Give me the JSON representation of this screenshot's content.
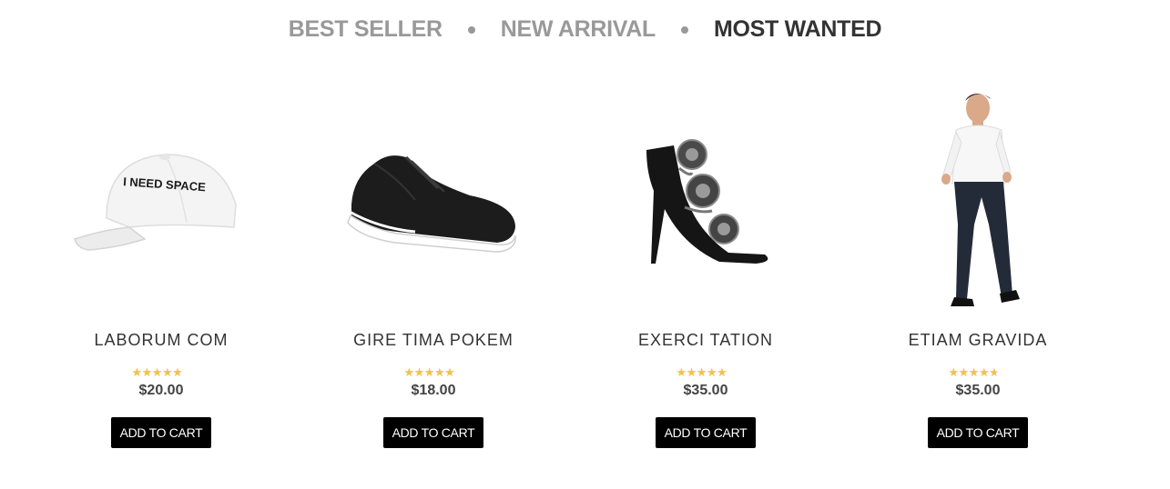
{
  "tabs": [
    {
      "label": "BEST SELLER",
      "active": false
    },
    {
      "label": "NEW ARRIVAL",
      "active": false
    },
    {
      "label": "MOST WANTED",
      "active": true
    }
  ],
  "products": [
    {
      "name": "LABORUM COM",
      "price": "$20.00",
      "rating": 5,
      "image": "white-baseball-cap",
      "cap_text": "I NEED SPACE",
      "button": "ADD TO CART"
    },
    {
      "name": "GIRE TIMA POKEM",
      "price": "$18.00",
      "rating": 5,
      "image": "black-sneaker",
      "button": "ADD TO CART"
    },
    {
      "name": "EXERCI TATION",
      "price": "$35.00",
      "rating": 4.5,
      "image": "black-floral-sandal",
      "button": "ADD TO CART"
    },
    {
      "name": "ETIAM GRAVIDA",
      "price": "$35.00",
      "rating": 4,
      "image": "man-white-shirt-jeans",
      "button": "ADD TO CART"
    }
  ]
}
